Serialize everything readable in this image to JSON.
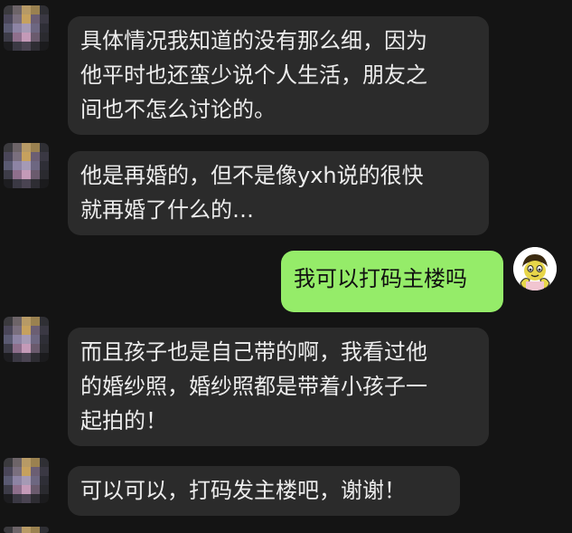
{
  "messages": [
    {
      "lines": [
        "具体情况我知道的没有那么细，因为",
        "他平时也还蛮少说个人生活，朋友之",
        "间也不怎么讨论的。"
      ]
    },
    {
      "lines": [
        "他是再婚的，但不是像yxh说的很快",
        "就再婚了什么的…"
      ]
    },
    {
      "lines": [
        "我可以打码主楼吗"
      ]
    },
    {
      "lines": [
        "而且孩子也是自己带的啊，我看过他",
        "的婚纱照，婚纱照都是带着小孩子一",
        "起拍的！"
      ]
    },
    {
      "lines": [
        "可以可以，打码发主楼吧，谢谢！"
      ]
    }
  ]
}
